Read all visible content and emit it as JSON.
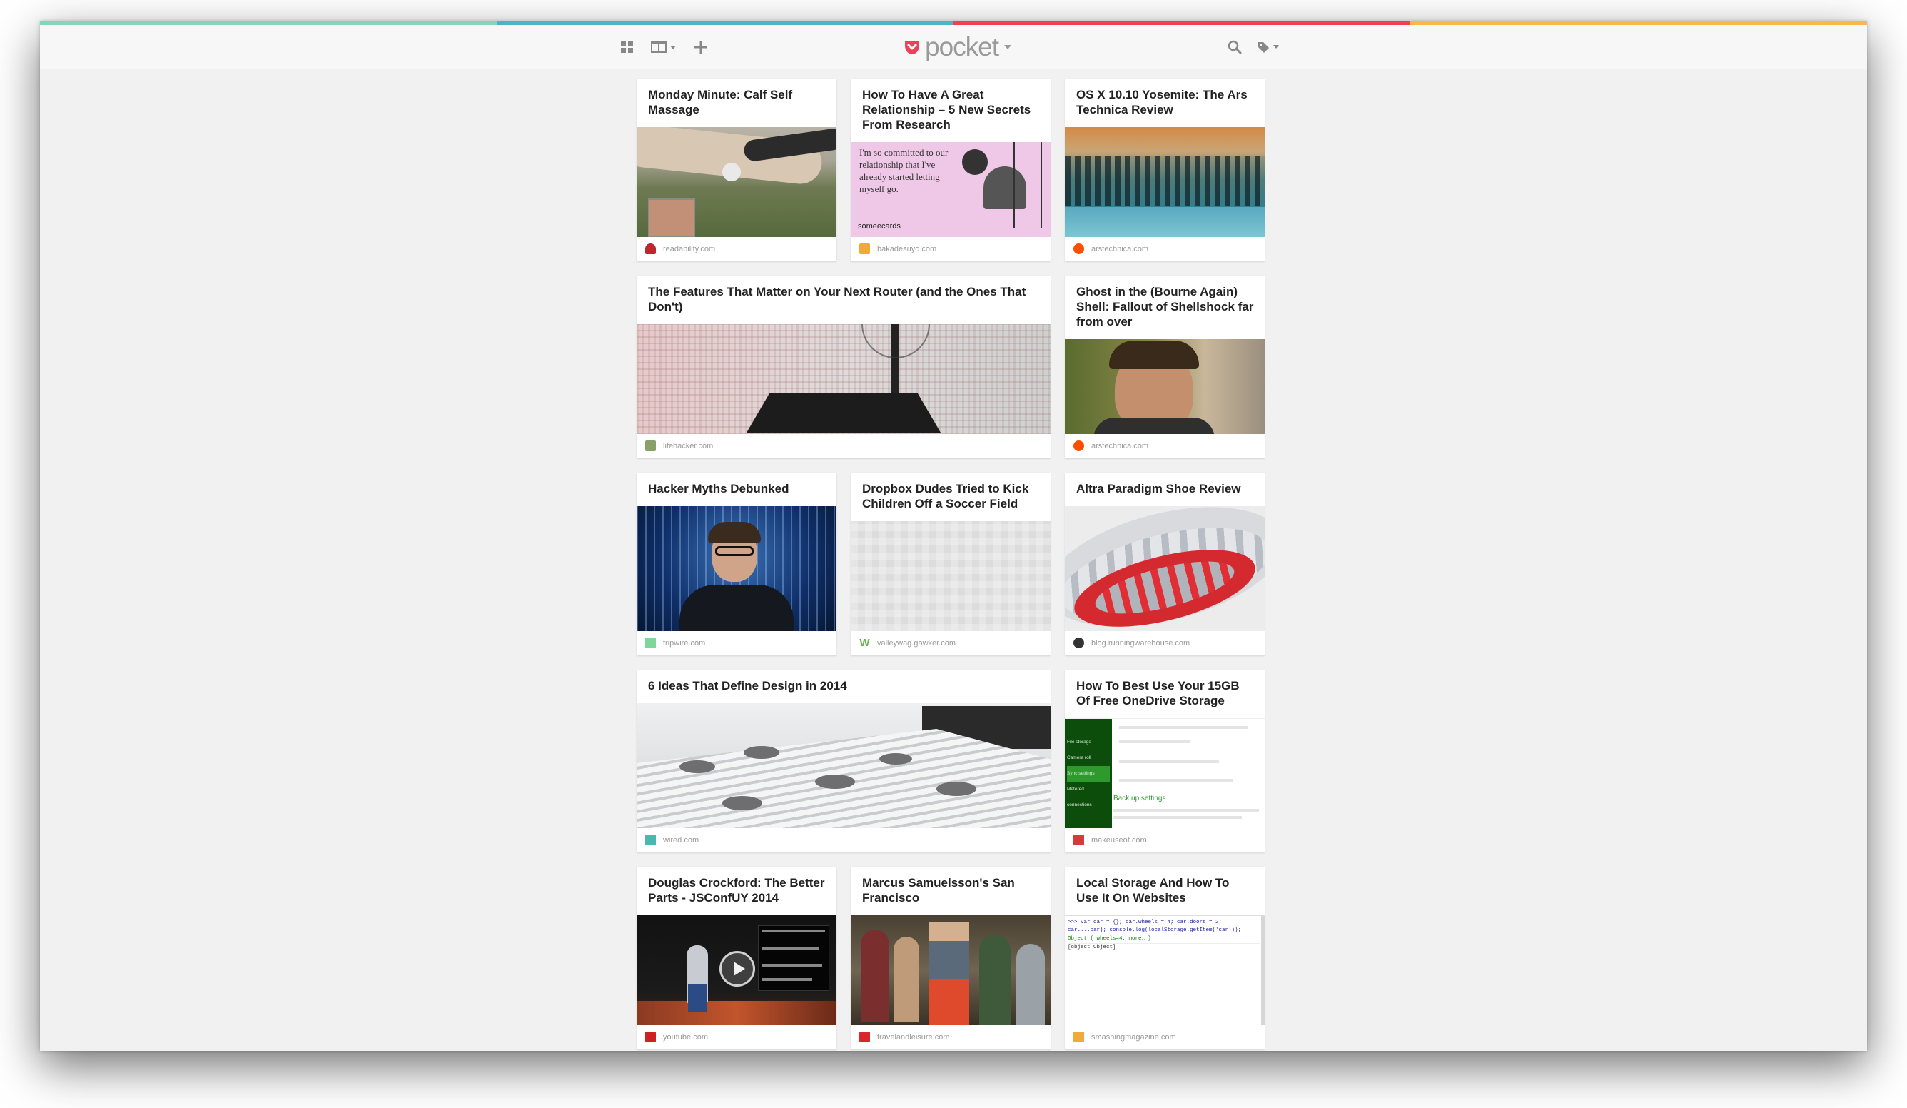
{
  "app": {
    "logo_text": "pocket",
    "accent_colors": [
      "#83d6b7",
      "#50b3c0",
      "#ee4056",
      "#fcb64e"
    ],
    "toolbar_icons": [
      "grid-view-icon",
      "list-view-icon",
      "add-icon",
      "search-icon",
      "tag-icon"
    ]
  },
  "cards": [
    {
      "title": "Monday Minute: Calf Self Massage",
      "source": "readability.com"
    },
    {
      "title": "How To Have A Great Relationship – 5 New Secrets From Research",
      "source": "bakadesuyo.com",
      "image_text": "I'm so committed to our relationship that I've already started letting myself go.",
      "image_brand": "someecards"
    },
    {
      "title": "OS X 10.10 Yosemite: The Ars Technica Review",
      "source": "arstechnica.com"
    },
    {
      "title": "The Features That Matter on Your Next Router (and the Ones That Don't)",
      "source": "lifehacker.com"
    },
    {
      "title": "Ghost in the (Bourne Again) Shell: Fallout of Shellshock far from over",
      "source": "arstechnica.com"
    },
    {
      "title": "Hacker Myths Debunked",
      "source": "tripwire.com"
    },
    {
      "title": "Dropbox Dudes Tried to Kick Children Off a Soccer Field",
      "source": "valleywag.gawker.com"
    },
    {
      "title": "Altra Paradigm Shoe Review",
      "source": "blog.runningwarehouse.com"
    },
    {
      "title": "6 Ideas That Define Design in 2014",
      "source": "wired.com"
    },
    {
      "title": "How To Best Use Your 15GB Of Free OneDrive Storage",
      "source": "makeuseof.com",
      "image_menu": [
        "File storage",
        "Camera roll",
        "Sync settings",
        "Metered connections"
      ],
      "image_link": "Back up settings"
    },
    {
      "title": "Douglas Crockford: The Better Parts - JSConfUY 2014",
      "source": "youtube.com"
    },
    {
      "title": "Marcus Samuelsson's San Francisco",
      "source": "travelandleisure.com"
    },
    {
      "title": "Local Storage And How To Use It On Websites",
      "source": "smashingmagazine.com",
      "image_code": [
        ">>> var car = {}; car.wheels = 4; car.doors = 2;",
        "car....car); console.log(localStorage.getItem('car'));",
        "Object { wheels=4,  more… }",
        "[object Object]"
      ]
    }
  ]
}
